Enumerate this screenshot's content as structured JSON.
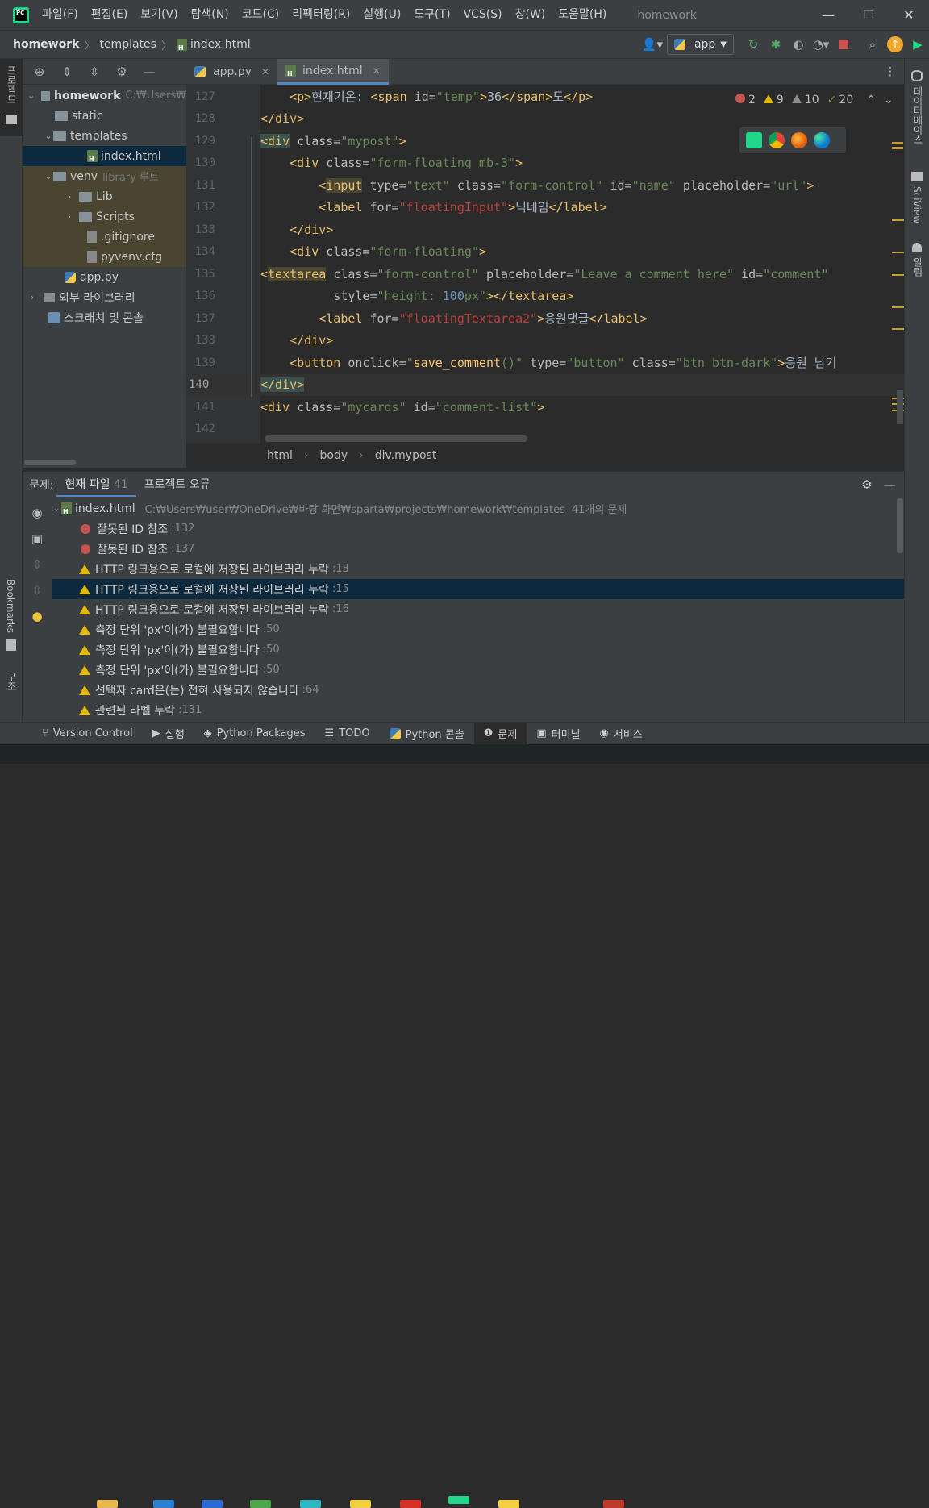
{
  "menu": {
    "items": [
      "파일(F)",
      "편집(E)",
      "보기(V)",
      "탐색(N)",
      "코드(C)",
      "리팩터링(R)",
      "실행(U)",
      "도구(T)",
      "VCS(S)",
      "창(W)",
      "도움말(H)"
    ],
    "project_title": "homework",
    "app_icon_text": "PC",
    "window_controls": [
      "—",
      "☐",
      "✕"
    ]
  },
  "nav": {
    "crumbs": [
      "homework",
      "templates",
      "index.html"
    ],
    "run_config": "app"
  },
  "left_strip": {
    "project_label": "프로젝트",
    "bookmarks_label": "Bookmarks",
    "structure_label": "구조"
  },
  "right_strip": {
    "database_label": "데이터베이스",
    "sciview_label": "SciView",
    "notifications_label": "알림"
  },
  "project_tree": {
    "rows": [
      {
        "label": "homework",
        "hint": "C:₩Users₩"
      },
      {
        "label": "static",
        "hint": ""
      },
      {
        "label": "templates",
        "hint": ""
      },
      {
        "label": "index.html",
        "hint": ""
      },
      {
        "label": "venv",
        "hint": "library 루트"
      },
      {
        "label": "Lib",
        "hint": ""
      },
      {
        "label": "Scripts",
        "hint": ""
      },
      {
        "label": ".gitignore",
        "hint": ""
      },
      {
        "label": "pyvenv.cfg",
        "hint": ""
      },
      {
        "label": "app.py",
        "hint": ""
      },
      {
        "label": "외부 라이브러리",
        "hint": ""
      },
      {
        "label": "스크래치 및 콘솔",
        "hint": ""
      }
    ]
  },
  "tabs": [
    {
      "label": "app.py"
    },
    {
      "label": "index.html"
    }
  ],
  "editor": {
    "line_numbers": [
      "127",
      "128",
      "129",
      "130",
      "131",
      "132",
      "133",
      "134",
      "135",
      "136",
      "137",
      "138",
      "139",
      "140",
      "141",
      "142"
    ],
    "current_line": "140",
    "inspections": {
      "errors": "2",
      "warnings": "9",
      "weak_warnings": "10",
      "typos": "20"
    }
  },
  "code_breadcrumb": [
    "html",
    "body",
    "div.mypost"
  ],
  "problems": {
    "label": "문제:",
    "tab_current": "현재 파일",
    "tab_current_count": "41",
    "tab_project": "프로젝트 오류",
    "file": {
      "name": "index.html",
      "path": "C:₩Users₩user₩OneDrive₩바탕 화면₩sparta₩projects₩homework₩templates",
      "count": "41개의 문제"
    },
    "items": [
      {
        "severity": "error",
        "text": "잘못된 ID 참조",
        "line": ":132"
      },
      {
        "severity": "error",
        "text": "잘못된 ID 참조",
        "line": ":137"
      },
      {
        "severity": "warning",
        "text": "HTTP 링크용으로 로컬에 저장된 라이브러리 누락",
        "line": ":13"
      },
      {
        "severity": "warning",
        "text": "HTTP 링크용으로 로컬에 저장된 라이브러리 누락",
        "line": ":15"
      },
      {
        "severity": "warning",
        "text": "HTTP 링크용으로 로컬에 저장된 라이브러리 누락",
        "line": ":16"
      },
      {
        "severity": "warning",
        "text": "측정 단위 'px'이(가) 불필요합니다",
        "line": ":50"
      },
      {
        "severity": "warning",
        "text": "측정 단위 'px'이(가) 불필요합니다",
        "line": ":50"
      },
      {
        "severity": "warning",
        "text": "측정 단위 'px'이(가) 불필요합니다",
        "line": ":50"
      },
      {
        "severity": "warning",
        "text": "선택자 card은(는) 전혀 사용되지 않습니다",
        "line": ":64"
      },
      {
        "severity": "warning",
        "text": "관련된 라벨 누락",
        "line": ":131"
      }
    ]
  },
  "bottom_tools": [
    "Version Control",
    "실행",
    "Python Packages",
    "TODO",
    "Python 콘솔",
    "문제",
    "터미널",
    "서비스"
  ],
  "colors": {
    "accent": "#4a88c7",
    "error": "#c75450",
    "warning": "#e6b800",
    "selection": "#0d293e"
  }
}
